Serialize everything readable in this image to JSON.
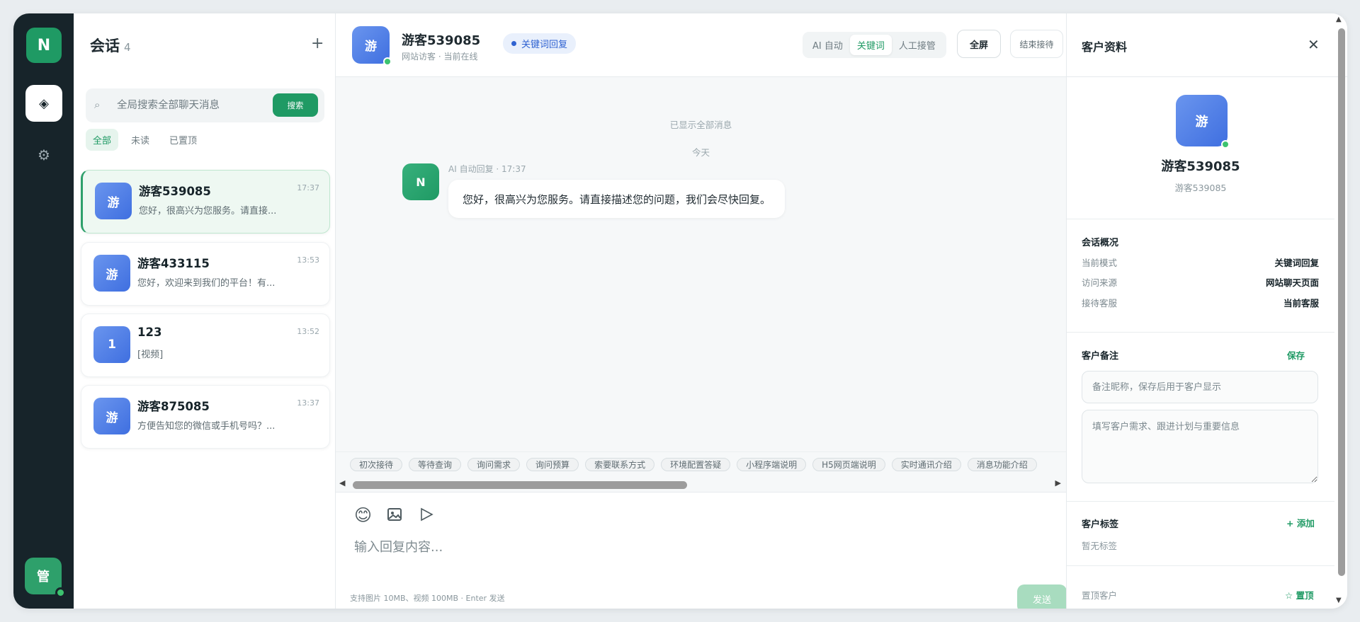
{
  "rail": {
    "logo": "N",
    "nav_icon": "◈",
    "settings_icon": "⚙",
    "admin": "管"
  },
  "conversations": {
    "title": "会话",
    "count": "4",
    "add_icon": "+",
    "search_placeholder": "全局搜索全部聊天消息",
    "search_button": "搜索",
    "filters": [
      "全部",
      "未读",
      "已置顶"
    ],
    "items": [
      {
        "avatar": "游",
        "name": "游客539085",
        "time": "17:37",
        "preview": "您好，很高兴为您服务。请直接..."
      },
      {
        "avatar": "游",
        "name": "游客433115",
        "time": "13:53",
        "preview": "您好，欢迎来到我们的平台！有..."
      },
      {
        "avatar": "1",
        "name": "123",
        "time": "13:52",
        "preview": "[视频]"
      },
      {
        "avatar": "游",
        "name": "游客875085",
        "time": "13:37",
        "preview": "方便告知您的微信或手机号吗？..."
      }
    ]
  },
  "chat": {
    "avatar": "游",
    "name": "游客539085",
    "subtitle": "网站访客 · 当前在线",
    "mode_badge": "关键词回复",
    "modes": [
      "AI 自动",
      "关键词",
      "人工接管"
    ],
    "fullscreen_label": "全屏",
    "end_label": "结束接待",
    "all_shown": "已显示全部消息",
    "date_label": "今天",
    "message": {
      "avatar": "N",
      "meta": "AI 自动回复 · 17:37",
      "text": "您好，很高兴为您服务。请直接描述您的问题，我们会尽快回复。"
    },
    "quick_replies": [
      "初次接待",
      "等待查询",
      "询问需求",
      "询问预算",
      "索要联系方式",
      "环境配置答疑",
      "小程序端说明",
      "H5网页端说明",
      "实时通讯介绍",
      "消息功能介绍"
    ],
    "reply_placeholder": "输入回复内容...",
    "hint": "支持图片 10MB、视频 100MB · Enter 发送",
    "send_label": "发送"
  },
  "profile": {
    "title": "客户资料",
    "close_icon": "✕",
    "avatar": "游",
    "name": "游客539085",
    "id": "游客539085",
    "overview_title": "会话概况",
    "overview": [
      {
        "label": "当前模式",
        "value": "关键词回复"
      },
      {
        "label": "访问来源",
        "value": "网站聊天页面"
      },
      {
        "label": "接待客服",
        "value": "当前客服"
      }
    ],
    "notes_title": "客户备注",
    "notes_save": "保存",
    "nickname_placeholder": "备注昵称，保存后用于客户显示",
    "notes_placeholder": "填写客户需求、跟进计划与重要信息",
    "tags_title": "客户标签",
    "tags_add": "+ 添加",
    "tags_empty": "暂无标签",
    "pin_label": "置顶客户",
    "pin_action": "☆ 置顶"
  },
  "colors": {
    "brand_green": "#1f9a64",
    "rail_dark": "#17242a",
    "accent_blue": "#2f62d1"
  }
}
